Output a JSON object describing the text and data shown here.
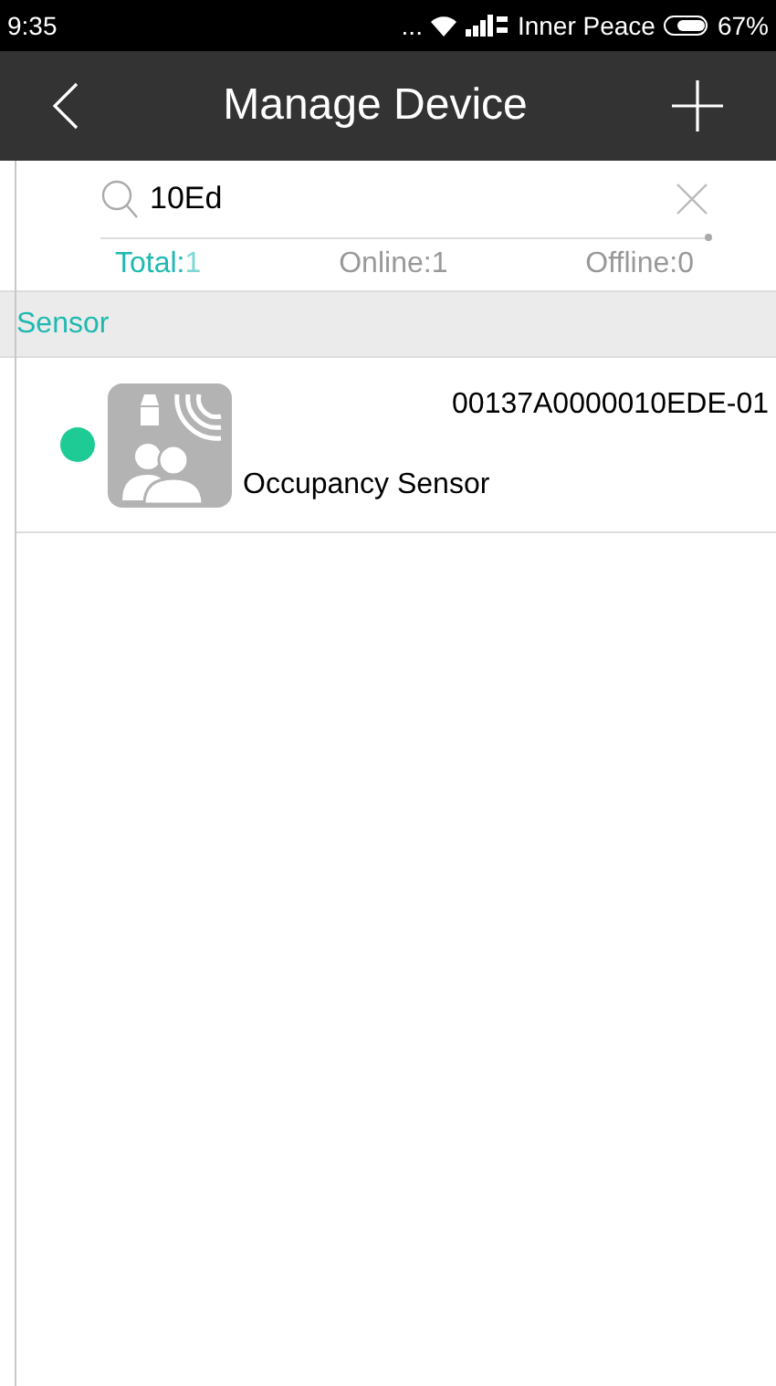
{
  "status_bar": {
    "time": "9:35",
    "dots": "...",
    "carrier": "Inner Peace",
    "battery": "67%"
  },
  "header": {
    "title": "Manage Device"
  },
  "search": {
    "value": "10Ed"
  },
  "filters": [
    {
      "label": "Total:",
      "count": "1",
      "selected": true
    },
    {
      "label": "Online:",
      "count": "1",
      "selected": false
    },
    {
      "label": "Offline:",
      "count": "0",
      "selected": false
    }
  ],
  "sections": [
    {
      "title": "Sensor",
      "devices": [
        {
          "id": "00137A0000010EDE-01",
          "name": "Occupancy Sensor",
          "online": true
        }
      ]
    }
  ]
}
